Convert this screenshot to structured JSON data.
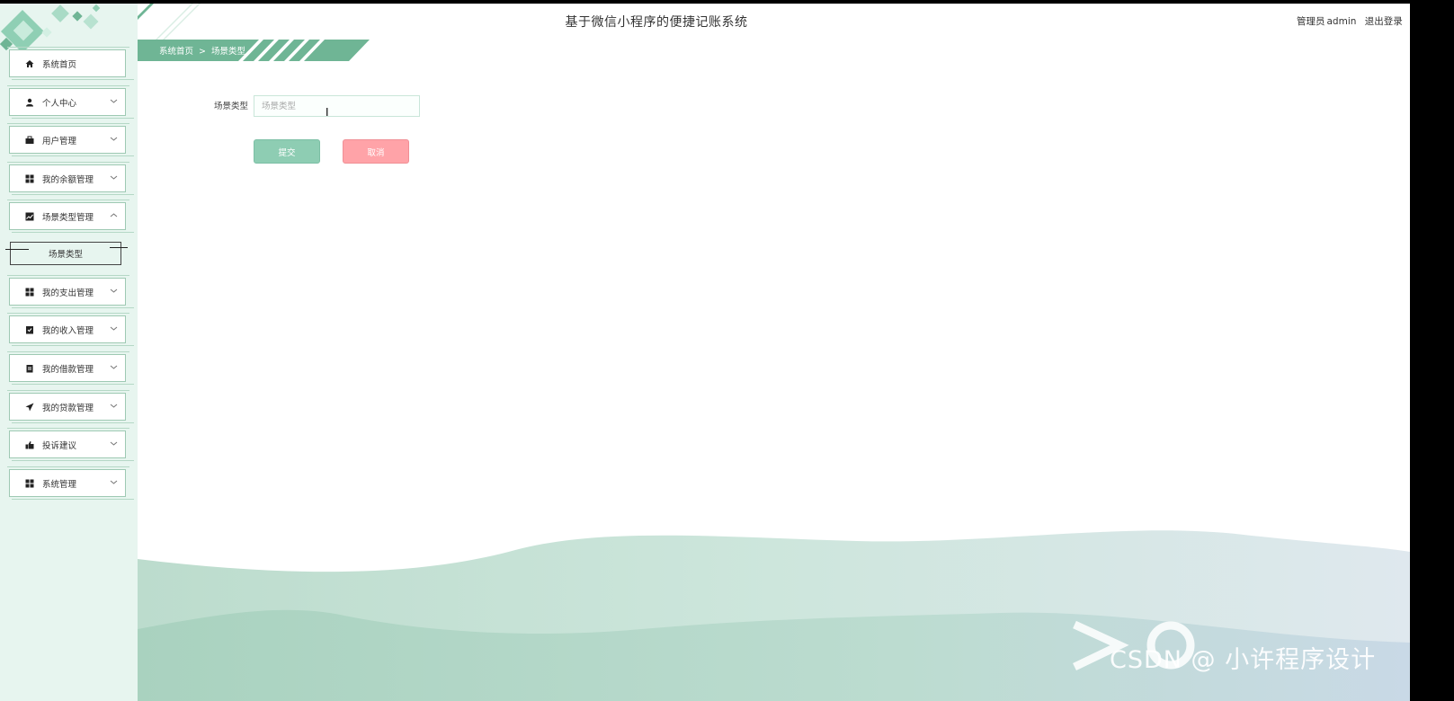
{
  "header": {
    "title": "基于微信小程序的便捷记账系统",
    "user_role": "管理员",
    "username": "admin",
    "logout_label": "退出登录"
  },
  "breadcrumb": {
    "home": "系统首页",
    "separator": ">",
    "current": "场景类型"
  },
  "sidebar": {
    "items": [
      {
        "label": "系统首页",
        "icon": "home-icon"
      },
      {
        "label": "个人中心",
        "icon": "user-icon"
      },
      {
        "label": "用户管理",
        "icon": "briefcase-icon"
      },
      {
        "label": "我的余额管理",
        "icon": "grid-icon"
      },
      {
        "label": "场景类型管理",
        "icon": "chart-icon"
      },
      {
        "label": "我的支出管理",
        "icon": "grid-icon"
      },
      {
        "label": "我的收入管理",
        "icon": "clipboard-check-icon"
      },
      {
        "label": "我的借款管理",
        "icon": "clipboard-icon"
      },
      {
        "label": "我的贷款管理",
        "icon": "send-icon"
      },
      {
        "label": "投诉建议",
        "icon": "thumbs-up-icon"
      },
      {
        "label": "系统管理",
        "icon": "grid-icon"
      }
    ],
    "submenu": {
      "label": "场景类型"
    }
  },
  "form": {
    "field_label": "场景类型",
    "field_placeholder": "场景类型",
    "field_value": "",
    "submit_label": "提交",
    "cancel_label": "取消"
  },
  "watermark": "CSDN @ 小许程序设计",
  "colors": {
    "accent": "#6fb595",
    "sidebar_bg": "#e7f5ef",
    "submit": "#8ecdb3",
    "cancel": "#ffa3a8"
  }
}
